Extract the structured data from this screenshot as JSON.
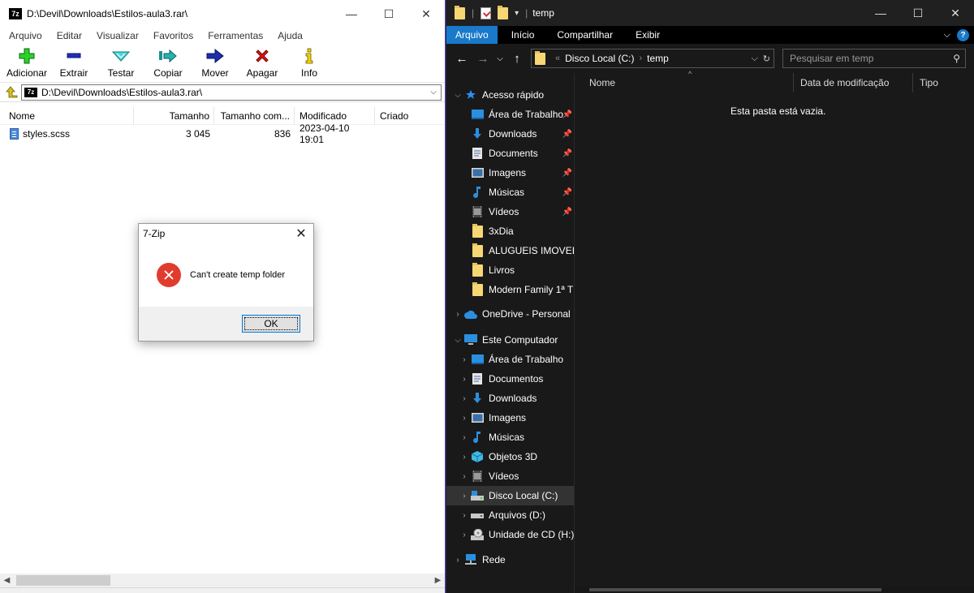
{
  "zip": {
    "title": "D:\\Devil\\Downloads\\Estilos-aula3.rar\\",
    "icon_label": "7z",
    "menu": [
      "Arquivo",
      "Editar",
      "Visualizar",
      "Favoritos",
      "Ferramentas",
      "Ajuda"
    ],
    "toolbar": {
      "add": "Adicionar",
      "extract": "Extrair",
      "test": "Testar",
      "copy": "Copiar",
      "move": "Mover",
      "delete": "Apagar",
      "info": "Info"
    },
    "address": "D:\\Devil\\Downloads\\Estilos-aula3.rar\\",
    "columns": {
      "name": "Nome",
      "size": "Tamanho",
      "packed": "Tamanho com...",
      "modified": "Modificado",
      "created": "Criado"
    },
    "files": [
      {
        "name": "styles.scss",
        "size": "3 045",
        "packed": "836",
        "modified": "2023-04-10 19:01",
        "created": ""
      }
    ]
  },
  "dialog": {
    "title": "7-Zip",
    "message": "Can't create temp folder",
    "ok": "OK"
  },
  "explorer": {
    "title": "temp",
    "ribbon": {
      "file": "Arquivo",
      "home": "Início",
      "share": "Compartilhar",
      "view": "Exibir"
    },
    "help": "?",
    "address": {
      "root": "Disco Local (C:)",
      "folder": "temp"
    },
    "search_placeholder": "Pesquisar em temp",
    "columns": {
      "name": "Nome",
      "modified": "Data de modificação",
      "type": "Tipo"
    },
    "empty_text": "Esta pasta está vazia.",
    "quick_access": {
      "label": "Acesso rápido",
      "items": [
        "Área de Trabalho",
        "Downloads",
        "Documents",
        "Imagens",
        "Músicas",
        "Vídeos",
        "3xDia",
        "ALUGUEIS IMOVEIS",
        "Livros",
        "Modern Family 1ª T"
      ]
    },
    "onedrive": "OneDrive - Personal",
    "this_pc": {
      "label": "Este Computador",
      "items": [
        "Área de Trabalho",
        "Documentos",
        "Downloads",
        "Imagens",
        "Músicas",
        "Objetos 3D",
        "Vídeos",
        "Disco Local (C:)",
        "Arquivos (D:)",
        "Unidade de CD (H:)"
      ]
    },
    "network": "Rede"
  },
  "colors": {
    "accent": "#1979ca",
    "error": "#e03c2e",
    "folder": "#f7d774"
  }
}
